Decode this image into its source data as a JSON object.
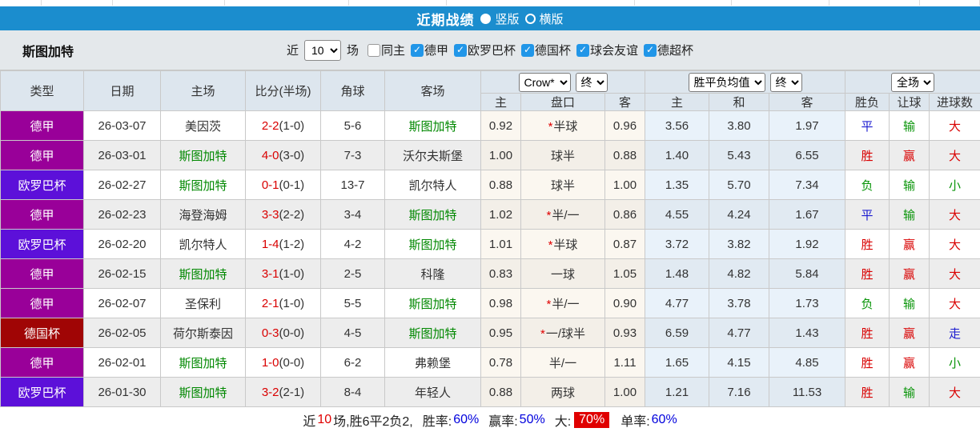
{
  "titlebar": {
    "title": "近期战绩",
    "radio_options": [
      {
        "label": "竖版",
        "selected": true
      },
      {
        "label": "横版",
        "selected": false
      }
    ]
  },
  "filterbar": {
    "team": "斯图加特",
    "near_label": "近",
    "games_value": "10",
    "games_unit": "场",
    "checkboxes": [
      {
        "label": "同主",
        "checked": false
      },
      {
        "label": "德甲",
        "checked": true
      },
      {
        "label": "欧罗巴杯",
        "checked": true
      },
      {
        "label": "德国杯",
        "checked": true
      },
      {
        "label": "球会友谊",
        "checked": true
      },
      {
        "label": "德超杯",
        "checked": true
      }
    ]
  },
  "table": {
    "static_headers": [
      "类型",
      "日期",
      "主场",
      "比分(半场)",
      "角球",
      "客场"
    ],
    "dropdowns": {
      "odds_company": "Crow*",
      "odds_time_1": "终",
      "avg_label": "胜平负均值",
      "odds_time_2": "终",
      "scope": "全场"
    },
    "sub_headers": [
      "主",
      "盘口",
      "客",
      "主",
      "和",
      "客",
      "胜负",
      "让球",
      "进球数"
    ],
    "rows": [
      {
        "league": "德甲",
        "league_color": "#990099",
        "date": "26-03-07",
        "home": "美因茨",
        "home_self": false,
        "score": "2-2",
        "half": "(1-0)",
        "corner": "5-6",
        "away": "斯图加特",
        "away_self": true,
        "odds_home": "0.92",
        "star": true,
        "handicap": "半球",
        "odds_away": "0.96",
        "avg_home": "3.56",
        "avg_draw": "3.80",
        "avg_away": "1.97",
        "result": {
          "text": "平",
          "color": "blue"
        },
        "handicap_result": {
          "text": "输",
          "color": "green"
        },
        "goal_result": {
          "text": "大",
          "color": "red"
        }
      },
      {
        "league": "德甲",
        "league_color": "#990099",
        "date": "26-03-01",
        "home": "斯图加特",
        "home_self": true,
        "score": "4-0",
        "half": "(3-0)",
        "corner": "7-3",
        "away": "沃尔夫斯堡",
        "away_self": false,
        "odds_home": "1.00",
        "star": false,
        "handicap": "球半",
        "odds_away": "0.88",
        "avg_home": "1.40",
        "avg_draw": "5.43",
        "avg_away": "6.55",
        "result": {
          "text": "胜",
          "color": "red"
        },
        "handicap_result": {
          "text": "赢",
          "color": "red"
        },
        "goal_result": {
          "text": "大",
          "color": "red"
        }
      },
      {
        "league": "欧罗巴杯",
        "league_color": "#5c10d9",
        "date": "26-02-27",
        "home": "斯图加特",
        "home_self": true,
        "score": "0-1",
        "half": "(0-1)",
        "corner": "13-7",
        "away": "凯尔特人",
        "away_self": false,
        "odds_home": "0.88",
        "star": false,
        "handicap": "球半",
        "odds_away": "1.00",
        "avg_home": "1.35",
        "avg_draw": "5.70",
        "avg_away": "7.34",
        "result": {
          "text": "负",
          "color": "green"
        },
        "handicap_result": {
          "text": "输",
          "color": "green"
        },
        "goal_result": {
          "text": "小",
          "color": "green"
        }
      },
      {
        "league": "德甲",
        "league_color": "#990099",
        "date": "26-02-23",
        "home": "海登海姆",
        "home_self": false,
        "score": "3-3",
        "half": "(2-2)",
        "corner": "3-4",
        "away": "斯图加特",
        "away_self": true,
        "odds_home": "1.02",
        "star": true,
        "handicap": "半/一",
        "odds_away": "0.86",
        "avg_home": "4.55",
        "avg_draw": "4.24",
        "avg_away": "1.67",
        "result": {
          "text": "平",
          "color": "blue"
        },
        "handicap_result": {
          "text": "输",
          "color": "green"
        },
        "goal_result": {
          "text": "大",
          "color": "red"
        }
      },
      {
        "league": "欧罗巴杯",
        "league_color": "#5c10d9",
        "date": "26-02-20",
        "home": "凯尔特人",
        "home_self": false,
        "score": "1-4",
        "half": "(1-2)",
        "corner": "4-2",
        "away": "斯图加特",
        "away_self": true,
        "odds_home": "1.01",
        "star": true,
        "handicap": "半球",
        "odds_away": "0.87",
        "avg_home": "3.72",
        "avg_draw": "3.82",
        "avg_away": "1.92",
        "result": {
          "text": "胜",
          "color": "red"
        },
        "handicap_result": {
          "text": "赢",
          "color": "red"
        },
        "goal_result": {
          "text": "大",
          "color": "red"
        }
      },
      {
        "league": "德甲",
        "league_color": "#990099",
        "date": "26-02-15",
        "home": "斯图加特",
        "home_self": true,
        "score": "3-1",
        "half": "(1-0)",
        "corner": "2-5",
        "away": "科隆",
        "away_self": false,
        "odds_home": "0.83",
        "star": false,
        "handicap": "一球",
        "odds_away": "1.05",
        "avg_home": "1.48",
        "avg_draw": "4.82",
        "avg_away": "5.84",
        "result": {
          "text": "胜",
          "color": "red"
        },
        "handicap_result": {
          "text": "赢",
          "color": "red"
        },
        "goal_result": {
          "text": "大",
          "color": "red"
        }
      },
      {
        "league": "德甲",
        "league_color": "#990099",
        "date": "26-02-07",
        "home": "圣保利",
        "home_self": false,
        "score": "2-1",
        "half": "(1-0)",
        "corner": "5-5",
        "away": "斯图加特",
        "away_self": true,
        "odds_home": "0.98",
        "star": true,
        "handicap": "半/一",
        "odds_away": "0.90",
        "avg_home": "4.77",
        "avg_draw": "3.78",
        "avg_away": "1.73",
        "result": {
          "text": "负",
          "color": "green"
        },
        "handicap_result": {
          "text": "输",
          "color": "green"
        },
        "goal_result": {
          "text": "大",
          "color": "red"
        }
      },
      {
        "league": "德国杯",
        "league_color": "#a00505",
        "date": "26-02-05",
        "home": "荷尔斯泰因",
        "home_self": false,
        "score": "0-3",
        "half": "(0-0)",
        "corner": "4-5",
        "away": "斯图加特",
        "away_self": true,
        "odds_home": "0.95",
        "star": true,
        "handicap": "一/球半",
        "odds_away": "0.93",
        "avg_home": "6.59",
        "avg_draw": "4.77",
        "avg_away": "1.43",
        "result": {
          "text": "胜",
          "color": "red"
        },
        "handicap_result": {
          "text": "赢",
          "color": "red"
        },
        "goal_result": {
          "text": "走",
          "color": "blue"
        }
      },
      {
        "league": "德甲",
        "league_color": "#990099",
        "date": "26-02-01",
        "home": "斯图加特",
        "home_self": true,
        "score": "1-0",
        "half": "(0-0)",
        "corner": "6-2",
        "away": "弗赖堡",
        "away_self": false,
        "odds_home": "0.78",
        "star": false,
        "handicap": "半/一",
        "odds_away": "1.11",
        "avg_home": "1.65",
        "avg_draw": "4.15",
        "avg_away": "4.85",
        "result": {
          "text": "胜",
          "color": "red"
        },
        "handicap_result": {
          "text": "赢",
          "color": "red"
        },
        "goal_result": {
          "text": "小",
          "color": "green"
        }
      },
      {
        "league": "欧罗巴杯",
        "league_color": "#5c10d9",
        "date": "26-01-30",
        "home": "斯图加特",
        "home_self": true,
        "score": "3-2",
        "half": "(2-1)",
        "corner": "8-4",
        "away": "年轻人",
        "away_self": false,
        "odds_home": "0.88",
        "star": false,
        "handicap": "两球",
        "odds_away": "1.00",
        "avg_home": "1.21",
        "avg_draw": "7.16",
        "avg_away": "11.53",
        "result": {
          "text": "胜",
          "color": "red"
        },
        "handicap_result": {
          "text": "输",
          "color": "green"
        },
        "goal_result": {
          "text": "大",
          "color": "red"
        }
      }
    ]
  },
  "footer": {
    "prefix": "近",
    "count": "10",
    "summary": "场,胜6平2负2,",
    "win_rate_label": "胜率:",
    "win_rate": "60%",
    "handicap_rate_label": "赢率:",
    "handicap_rate": "50%",
    "big_label": "大:",
    "big_rate": "70%",
    "single_rate_label": "单率:",
    "single_rate": "60%"
  }
}
